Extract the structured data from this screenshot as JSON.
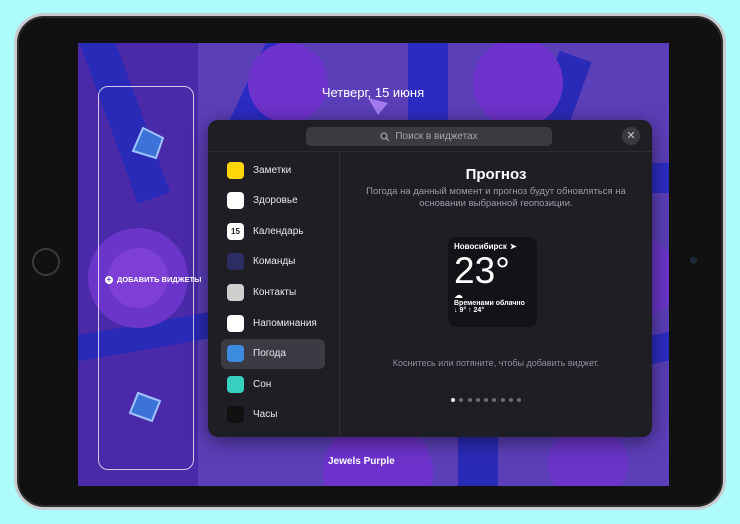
{
  "lock_screen": {
    "date": "Четверг, 15 июня",
    "wallpaper_caption": "Jewels Purple",
    "add_widgets_label": "ДОБАВИТЬ ВИДЖЕТЫ"
  },
  "gallery": {
    "search_placeholder": "Поиск в виджетах",
    "close_label": "✕",
    "apps": [
      {
        "label": "Заметки",
        "icon": "notes-icon",
        "color": "#ffd60a"
      },
      {
        "label": "Здоровье",
        "icon": "health-icon",
        "color": "#ffffff"
      },
      {
        "label": "Календарь",
        "icon": "calendar-icon",
        "color": "#ffffff",
        "badge": "15"
      },
      {
        "label": "Команды",
        "icon": "shortcuts-icon",
        "color": "#2d2d63"
      },
      {
        "label": "Контакты",
        "icon": "contacts-icon",
        "color": "#cfcfcf"
      },
      {
        "label": "Напоминания",
        "icon": "reminders-icon",
        "color": "#ffffff"
      },
      {
        "label": "Погода",
        "icon": "weather-icon",
        "color": "#3b8be0"
      },
      {
        "label": "Сон",
        "icon": "sleep-icon",
        "color": "#35d0c0"
      },
      {
        "label": "Часы",
        "icon": "clock-icon",
        "color": "#111111"
      },
      {
        "label": "",
        "icon": "partial-app-icon",
        "color": "#5b4bd6"
      }
    ],
    "selected_index": 6,
    "detail": {
      "title": "Прогноз",
      "description": "Погода на данный момент и прогноз будут обновляться на основании выбранной геопозиции.",
      "hint": "Коснитесь или потяните, чтобы добавить виджет.",
      "page_count": 9,
      "active_page": 0
    },
    "weather_widget": {
      "city": "Новосибирск",
      "temperature": "23°",
      "condition": "Временами облачно",
      "range": "↓ 9° ↑ 24°"
    }
  },
  "colors": {
    "wallpaper_base": "#5b3fb8",
    "panel_bg": "#1e1e24",
    "selected_row": "#3b3b43",
    "device_frame": "#c9cdd1"
  }
}
